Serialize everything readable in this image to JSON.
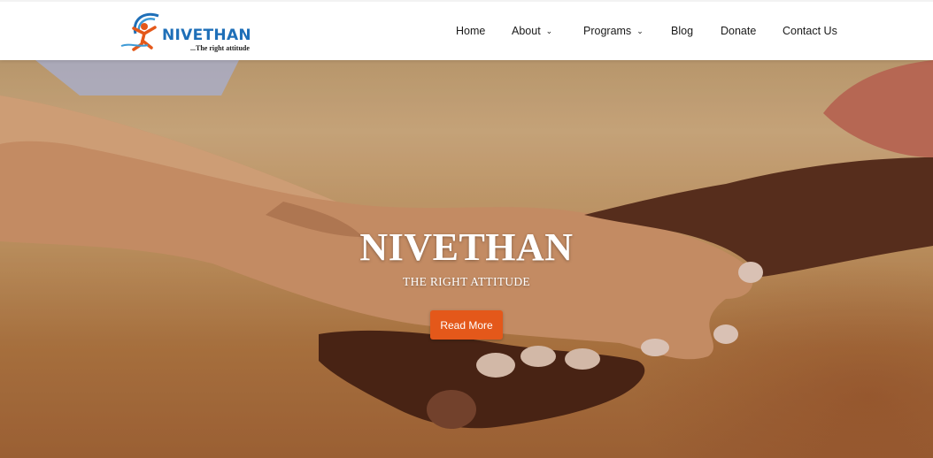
{
  "brand": {
    "name": "NIVETHAN",
    "tagline": "...The right attitude",
    "logo_icon": "person-figure-logo-icon",
    "colors": {
      "primary": "#1e6fb8",
      "accent": "#e4581a"
    }
  },
  "nav": {
    "items": [
      {
        "label": "Home",
        "has_dropdown": false
      },
      {
        "label": "About",
        "has_dropdown": true
      },
      {
        "label": "Programs",
        "has_dropdown": true
      },
      {
        "label": "Blog",
        "has_dropdown": false
      },
      {
        "label": "Donate",
        "has_dropdown": false
      },
      {
        "label": "Contact Us",
        "has_dropdown": false
      }
    ],
    "dropdown_icon": "chevron-down-icon"
  },
  "hero": {
    "title": "NIVETHAN",
    "subtitle": "THE RIGHT ATTITUDE",
    "button_label": "Read More",
    "background_image": "holding-hands-photo"
  }
}
